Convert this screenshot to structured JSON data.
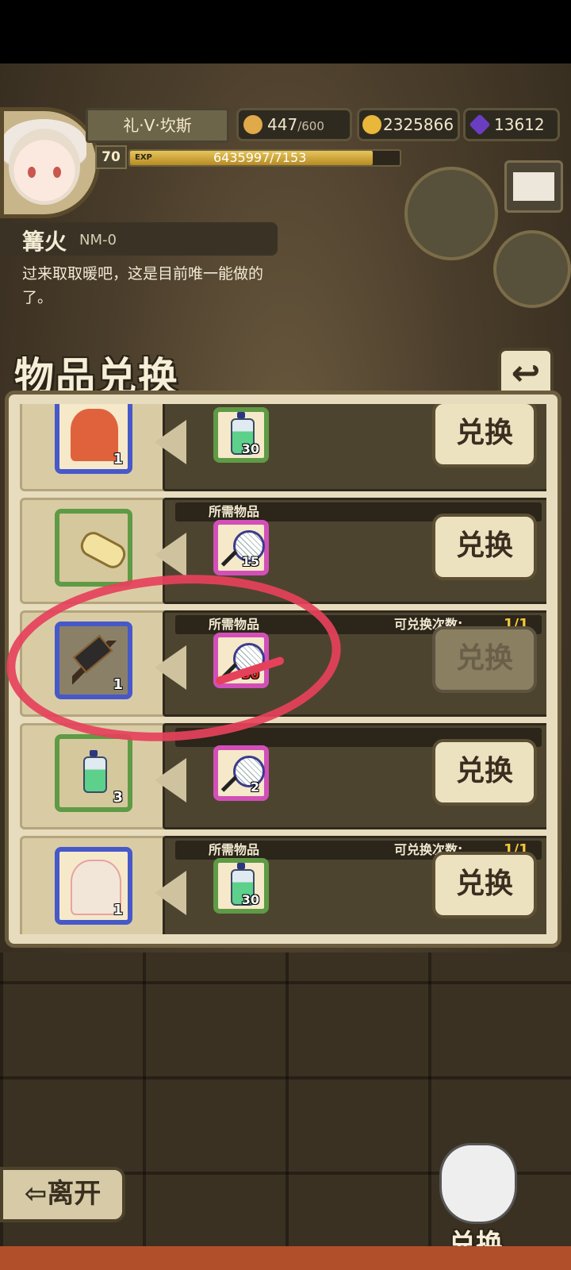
{
  "player": {
    "name": "礼·V·坎斯",
    "level": "70",
    "exp_label": "EXP",
    "exp_text": "6435997/7153",
    "exp_progress": 0.9
  },
  "resources": {
    "stamina": "447",
    "stamina_max": "/600",
    "gold": "2325866",
    "gems": "13612"
  },
  "location": {
    "title": "篝火",
    "code": "NM-0",
    "description": "过来取取暖吧，这是目前唯一能做的了。"
  },
  "panel": {
    "title": "物品兑换",
    "back_glyph": "↩",
    "req_label": "所需物品",
    "count_label": "可兑换次数:",
    "rows": [
      {
        "give_qty": "1",
        "req_qty": "30",
        "btn": "兑换"
      },
      {
        "give_qty": "",
        "req_qty": "15",
        "btn": "兑换"
      },
      {
        "give_qty": "1",
        "req_qty": "30",
        "btn": "兑换",
        "count": "1/1"
      },
      {
        "give_qty": "3",
        "req_qty": "2",
        "btn": "兑换"
      },
      {
        "give_qty": "1",
        "req_qty": "30",
        "btn": "兑换",
        "count": "1/1"
      }
    ]
  },
  "bottom": {
    "leave": "⇦离开",
    "exchange": "兑换"
  },
  "colors": {
    "accent_red": "#e6415b",
    "gold_text": "#f4c63b"
  }
}
